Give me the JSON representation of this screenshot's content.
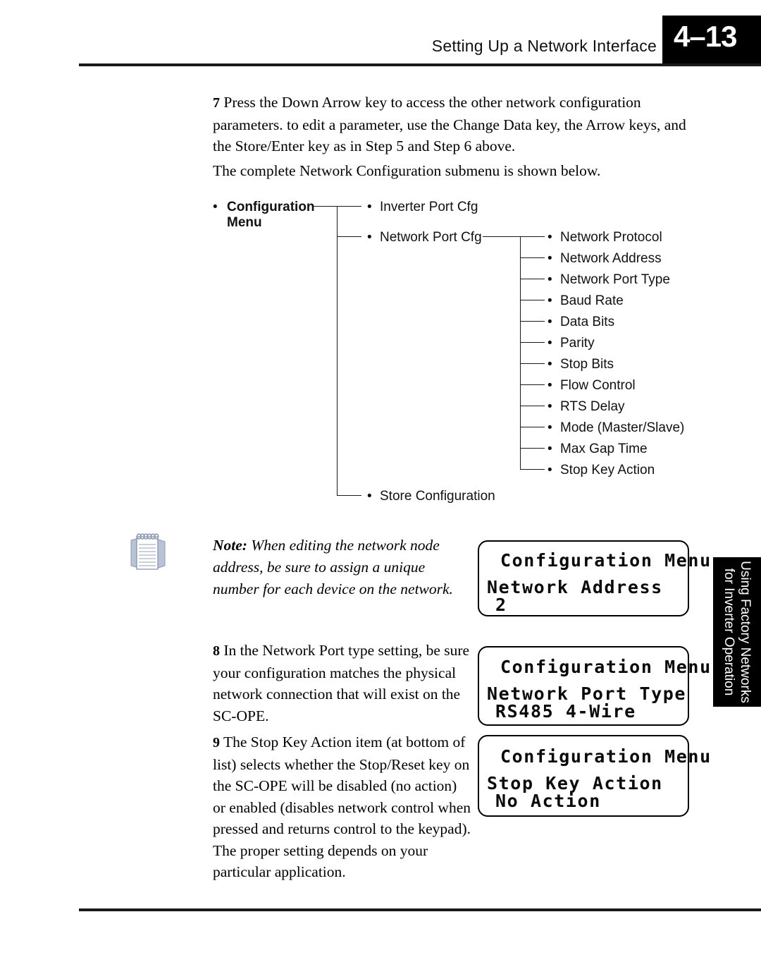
{
  "header": {
    "title": "Setting Up a Network Interface",
    "page_number": "4–13"
  },
  "body": {
    "step7_number": "7",
    "step7_text": "Press the Down Arrow key to access the other network configuration parameters. to edit a parameter, use the Change Data key, the Arrow keys, and the Store/Enter key as in Step 5 and Step 6 above.",
    "intro_text": "The complete Network Configuration submenu is shown below.",
    "step8_number": "8",
    "step8_text": "In the Network Port type setting, be sure your configuration matches the physical network connection that will exist on the SC-OPE.",
    "step9_number": "9",
    "step9_text": "The Stop Key Action item (at bottom of list) selects whether the Stop/Reset key on the SC-OPE will be disabled (no action) or enabled (disables network control when pressed and returns control to the keypad). The proper setting depends on your particular application."
  },
  "tree": {
    "root_line1": "Configuration",
    "root_line2": "Menu",
    "level1": [
      "Inverter Port Cfg",
      "Network Port Cfg",
      "Store Configuration"
    ],
    "level2": [
      "Network Protocol",
      "Network Address",
      "Network Port Type",
      "Baud Rate",
      "Data Bits",
      "Parity",
      "Stop Bits",
      "Flow Control",
      "RTS Delay",
      "Mode (Master/Slave)",
      "Max Gap Time",
      "Stop Key Action"
    ],
    "bullet_glyph": "•"
  },
  "note": {
    "label": "Note:",
    "text": "When editing the network node address, be sure to assign a unique number for each device on the network.",
    "icon": "notepad-icon"
  },
  "lcd_panels": [
    {
      "line1": "Configuration Menu",
      "line2": "Network Address",
      "line3": "2"
    },
    {
      "line1": "Configuration Menu",
      "line2": "Network Port Type",
      "line3": "RS485 4-Wire"
    },
    {
      "line1": "Configuration Menu",
      "line2": "Stop Key Action",
      "line3": "No Action"
    }
  ],
  "side_tab": {
    "line1": "Using Factory Networks",
    "line2": "for Inverter Operation"
  },
  "colors": {
    "ink": "#000000",
    "paper": "#ffffff",
    "tab_background": "#000000",
    "tab_text": "#ffffff",
    "note_icon": "#8e9bb5"
  }
}
